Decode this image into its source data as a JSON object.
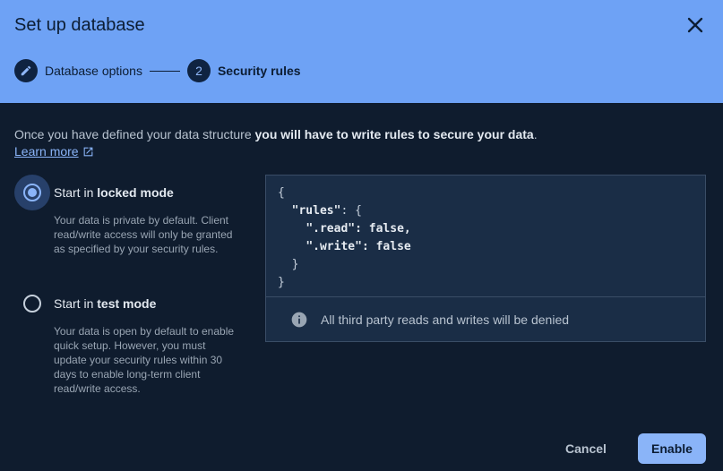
{
  "dialog": {
    "title": "Set up database"
  },
  "stepper": {
    "steps": [
      {
        "number": "",
        "label": "Database options",
        "icon": "pencil-icon"
      },
      {
        "number": "2",
        "label": "Security rules"
      }
    ]
  },
  "intro": {
    "text_prefix": "Once you have defined your data structure ",
    "text_bold": "you will have to write rules to secure your data",
    "text_suffix": ".",
    "learn_more": "Learn more"
  },
  "options": [
    {
      "title_prefix": "Start in ",
      "title_bold": "locked mode",
      "description": "Your data is private by default. Client read/write access will only be granted as specified by your security rules.",
      "selected": true
    },
    {
      "title_prefix": "Start in ",
      "title_bold": "test mode",
      "description": "Your data is open by default to enable quick setup. However, you must update your security rules within 30 days to enable long-term client read/write access.",
      "selected": false
    }
  ],
  "rules_code": {
    "line1": "{",
    "line2_key": "\"rules\"",
    "line2_rest": ": {",
    "line3_key": "\".read\"",
    "line3_rest": ": false,",
    "line4_key": "\".write\"",
    "line4_rest": ": false",
    "line5": "}",
    "line6": "}"
  },
  "notice": {
    "text": "All third party reads and writes will be denied",
    "icon": "info-icon"
  },
  "actions": {
    "cancel": "Cancel",
    "enable": "Enable"
  },
  "colors": {
    "header_bg": "#6ea2f5",
    "body_bg": "#0f1c2e",
    "accent": "#8ab4f8"
  }
}
